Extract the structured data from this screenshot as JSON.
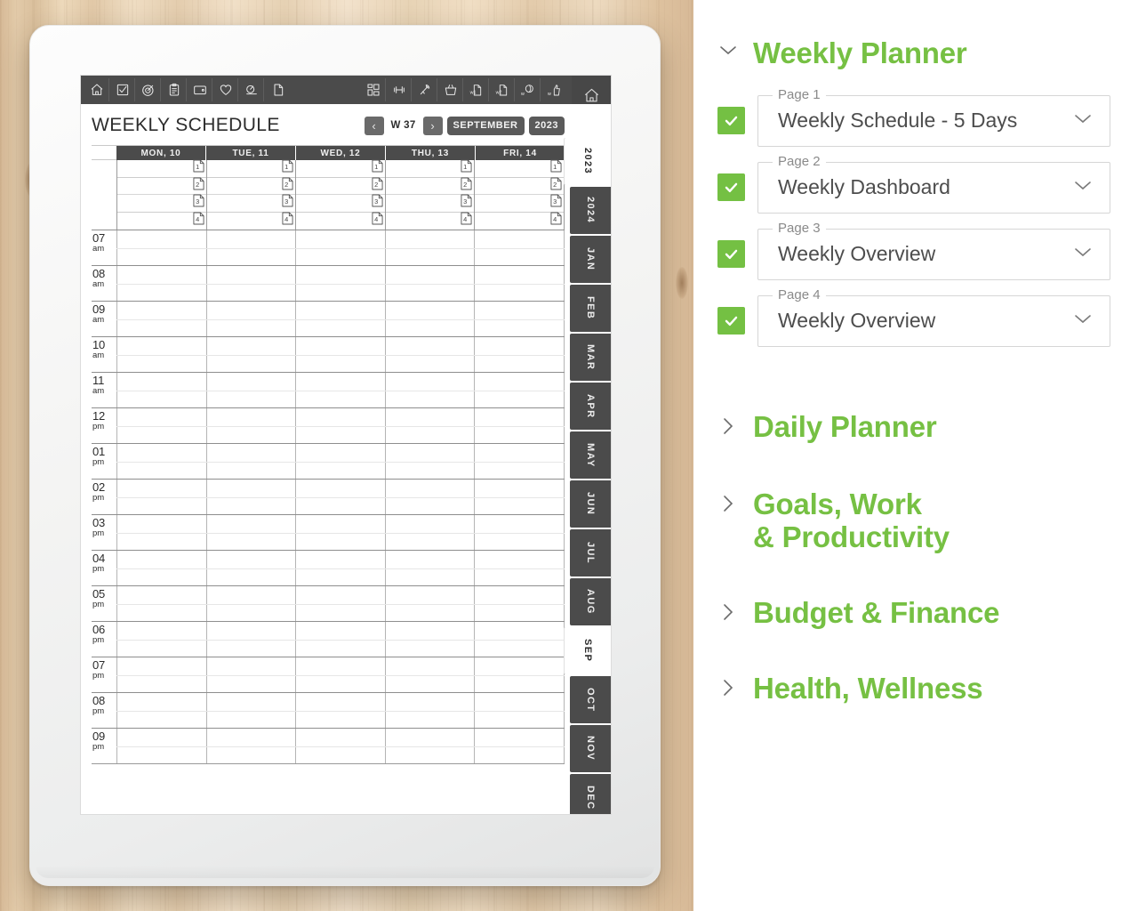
{
  "device": {
    "toolbar_left_icons": [
      "home-icon",
      "checkbox-icon",
      "target-icon",
      "clipboard-icon",
      "wallet-icon",
      "heart-icon",
      "finance-chart-icon",
      "document-icon"
    ],
    "toolbar_right_icons": [
      "grid-icon",
      "dumbbell-icon",
      "nutrition-icon",
      "basket-icon",
      "week1-page-icon",
      "week2-page-icon",
      "w-habit-icon",
      "w-thumbsup-icon"
    ],
    "toolbar_home_icon": "home-icon",
    "schedule": {
      "title": "WEEKLY SCHEDULE",
      "prev_label": "‹",
      "next_label": "›",
      "week_label": "W 37",
      "month_label": "SEPTEMBER",
      "year_label": "2023",
      "day_columns": [
        "MON, 10",
        "TUE, 11",
        "WED, 12",
        "THU, 13",
        "FRI, 14"
      ],
      "task_slots": [
        "1",
        "2",
        "3",
        "4"
      ],
      "hours": [
        {
          "hour": "07",
          "meridiem": "am"
        },
        {
          "hour": "08",
          "meridiem": "am"
        },
        {
          "hour": "09",
          "meridiem": "am"
        },
        {
          "hour": "10",
          "meridiem": "am"
        },
        {
          "hour": "11",
          "meridiem": "am"
        },
        {
          "hour": "12",
          "meridiem": "pm"
        },
        {
          "hour": "01",
          "meridiem": "pm"
        },
        {
          "hour": "02",
          "meridiem": "pm"
        },
        {
          "hour": "03",
          "meridiem": "pm"
        },
        {
          "hour": "04",
          "meridiem": "pm"
        },
        {
          "hour": "05",
          "meridiem": "pm"
        },
        {
          "hour": "06",
          "meridiem": "pm"
        },
        {
          "hour": "07",
          "meridiem": "pm"
        },
        {
          "hour": "08",
          "meridiem": "pm"
        },
        {
          "hour": "09",
          "meridiem": "pm"
        }
      ]
    },
    "month_rail": [
      {
        "label": "2023",
        "active": true
      },
      {
        "label": "2024",
        "active": false
      },
      {
        "label": "JAN",
        "active": false
      },
      {
        "label": "FEB",
        "active": false
      },
      {
        "label": "MAR",
        "active": false
      },
      {
        "label": "APR",
        "active": false
      },
      {
        "label": "MAY",
        "active": false
      },
      {
        "label": "JUN",
        "active": false
      },
      {
        "label": "JUL",
        "active": false
      },
      {
        "label": "AUG",
        "active": false
      },
      {
        "label": "SEP",
        "active": true
      },
      {
        "label": "OCT",
        "active": false
      },
      {
        "label": "NOV",
        "active": false
      },
      {
        "label": "DEC",
        "active": false
      }
    ]
  },
  "panel": {
    "accent_color": "#76c043",
    "checkbox_color": "#74c043",
    "groups": [
      {
        "title": "Weekly Planner",
        "expanded": true,
        "chevron": "chevron-down-icon"
      },
      {
        "title": "Daily Planner",
        "expanded": false,
        "chevron": "chevron-right-icon"
      },
      {
        "title_line1": "Goals, Work",
        "title_line2": "& Productivity",
        "expanded": false,
        "chevron": "chevron-right-icon"
      },
      {
        "title": "Budget & Finance",
        "expanded": false,
        "chevron": "chevron-right-icon"
      },
      {
        "title": "Health, Wellness",
        "expanded": false,
        "chevron": "chevron-right-icon"
      }
    ],
    "pages": [
      {
        "legend": "Page 1",
        "value": "Weekly Schedule - 5 Days",
        "checked": true
      },
      {
        "legend": "Page 2",
        "value": "Weekly Dashboard",
        "checked": true
      },
      {
        "legend": "Page 3",
        "value": "Weekly Overview",
        "checked": true
      },
      {
        "legend": "Page 4",
        "value": "Weekly Overview",
        "checked": true
      }
    ]
  }
}
